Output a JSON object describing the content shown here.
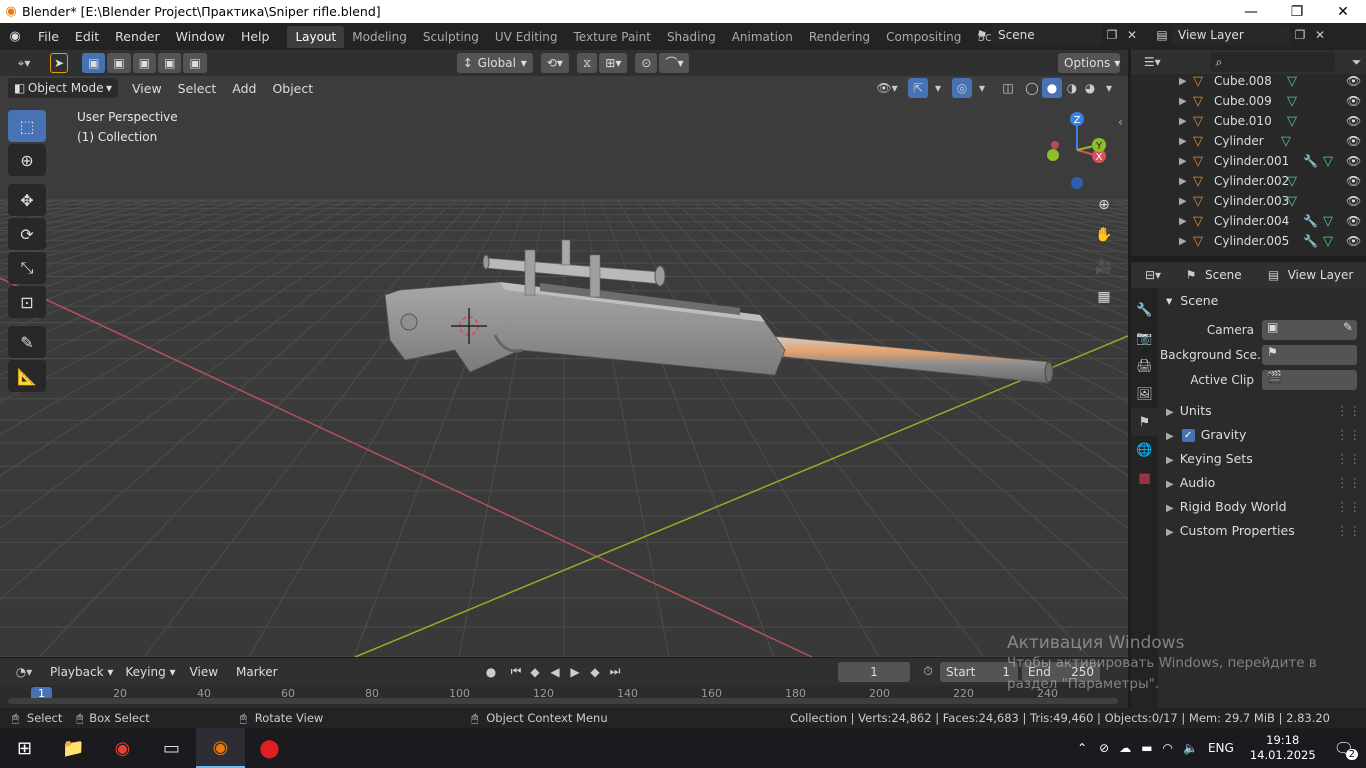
{
  "window": {
    "title": "Blender* [E:\\Blender Project\\Практика\\Sniper rifle.blend]",
    "minimize": "—",
    "maximize": "❐",
    "close": "✕"
  },
  "menu": {
    "items": [
      "File",
      "Edit",
      "Render",
      "Window",
      "Help"
    ]
  },
  "workspaces": [
    "Layout",
    "Modeling",
    "Sculpting",
    "UV Editing",
    "Texture Paint",
    "Shading",
    "Animation",
    "Rendering",
    "Compositing",
    "Scripting"
  ],
  "add_workspace": "+",
  "scene_selector": {
    "value": "Scene"
  },
  "viewlayer_selector": {
    "value": "View Layer"
  },
  "tool_header": {
    "orientation": "Global",
    "options": "Options"
  },
  "viewport_header": {
    "mode": "Object Mode",
    "menus": [
      "View",
      "Select",
      "Add",
      "Object"
    ]
  },
  "viewport_overlay": {
    "line1": "User Perspective",
    "line2": "(1) Collection"
  },
  "gizmo": {
    "z": "Z",
    "y": "Y",
    "x": "X"
  },
  "outliner": {
    "rows": [
      {
        "name": "Cube.008",
        "modifier": false
      },
      {
        "name": "Cube.009",
        "modifier": false
      },
      {
        "name": "Cube.010",
        "modifier": false
      },
      {
        "name": "Cylinder",
        "modifier": false
      },
      {
        "name": "Cylinder.001",
        "modifier": true
      },
      {
        "name": "Cylinder.002",
        "modifier": false
      },
      {
        "name": "Cylinder.003",
        "modifier": false
      },
      {
        "name": "Cylinder.004",
        "modifier": true
      },
      {
        "name": "Cylinder.005",
        "modifier": true
      }
    ]
  },
  "properties": {
    "header_scene": "Scene",
    "header_viewlayer": "View Layer",
    "panel_title": "Scene",
    "camera_label": "Camera",
    "background_label": "Background Sce...",
    "active_clip_label": "Active Clip",
    "subpanels": [
      "Units",
      "Gravity",
      "Keying Sets",
      "Audio",
      "Rigid Body World",
      "Custom Properties"
    ],
    "gravity_checked": true
  },
  "timeline": {
    "menus": [
      "Playback",
      "Keying",
      "View",
      "Marker"
    ],
    "current_frame": "1",
    "start_label": "Start",
    "start_value": "1",
    "end_label": "End",
    "end_value": "250",
    "ruler": [
      "1",
      "20",
      "40",
      "60",
      "80",
      "100",
      "120",
      "140",
      "160",
      "180",
      "200",
      "220",
      "240"
    ]
  },
  "statusbar": {
    "select": "Select",
    "box_select": "Box Select",
    "rotate_view": "Rotate View",
    "context_menu": "Object Context Menu",
    "stats": "Collection | Verts:24,862 | Faces:24,683 | Tris:49,460 | Objects:0/17 | Mem: 29.7 MiB | 2.83.20"
  },
  "watermark": {
    "line1": "Активация Windows",
    "line2": "Чтобы активировать Windows, перейдите в раздел \"Параметры\"."
  },
  "taskbar": {
    "language": "ENG",
    "time": "19:18",
    "date": "14.01.2025",
    "notifications": "2"
  },
  "colors": {
    "accent": "#4772b3",
    "object_orange": "#e98c2f",
    "mesh_green": "#4ed19a",
    "x_axis": "#d8505e",
    "y_axis": "#9ec02f"
  }
}
